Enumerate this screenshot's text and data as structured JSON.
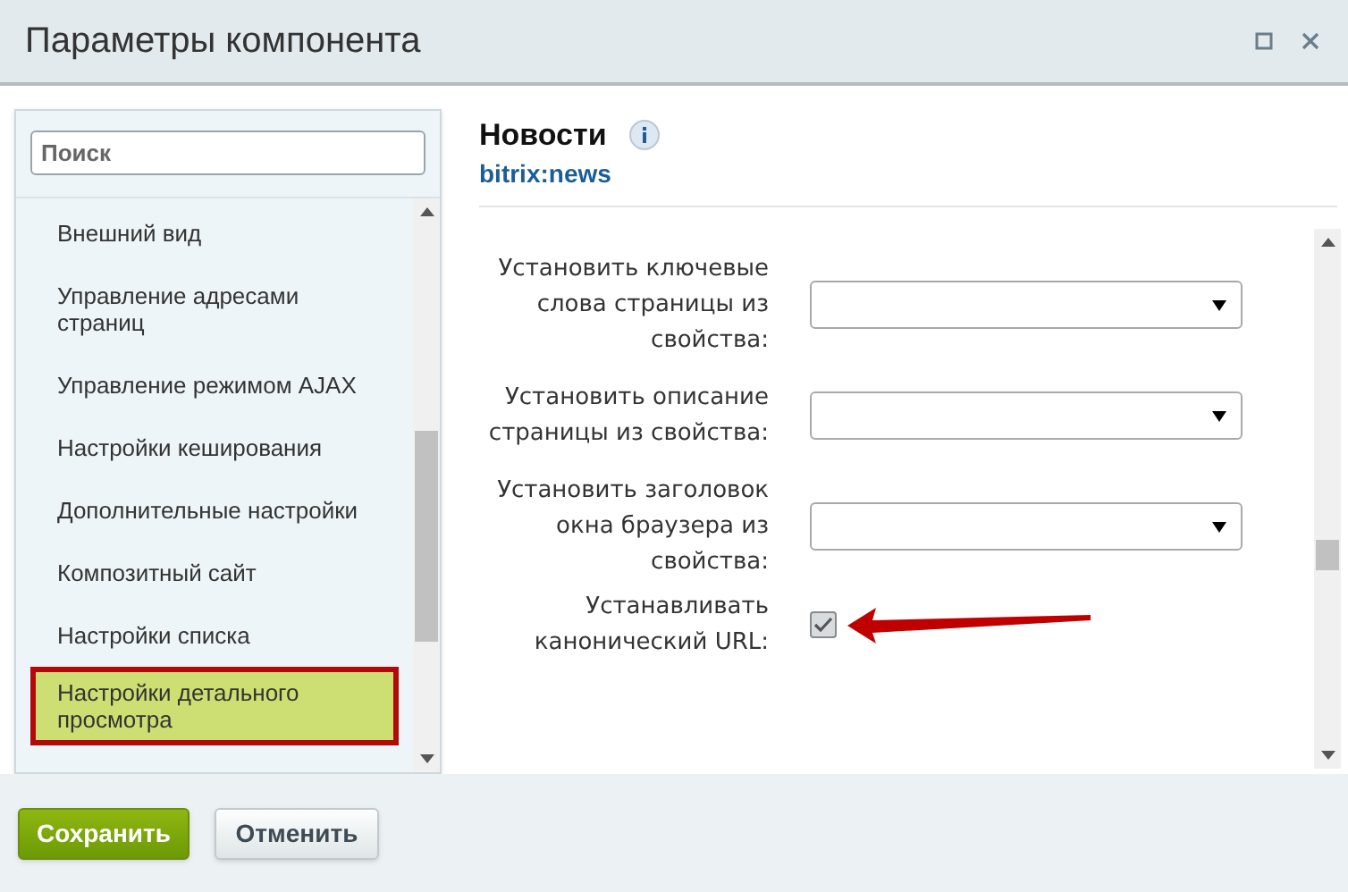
{
  "window": {
    "title": "Параметры компонента"
  },
  "sidebar": {
    "search": {
      "placeholder": "Поиск"
    },
    "items": [
      {
        "label": "Внешний вид",
        "selected": false
      },
      {
        "label": "Управление адресами страниц",
        "selected": false
      },
      {
        "label": "Управление режимом AJAX",
        "selected": false
      },
      {
        "label": "Настройки кеширования",
        "selected": false
      },
      {
        "label": "Дополнительные настройки",
        "selected": false
      },
      {
        "label": "Композитный сайт",
        "selected": false
      },
      {
        "label": "Настройки списка",
        "selected": false
      },
      {
        "label": "Настройки детального просмотра",
        "selected": true
      }
    ]
  },
  "component": {
    "title": "Новости",
    "code": "bitrix:news"
  },
  "fields": [
    {
      "kind": "select",
      "label": "Установить ключевые слова страницы из свойства:"
    },
    {
      "kind": "select",
      "label": "Установить описание страницы из свойства:"
    },
    {
      "kind": "select",
      "label": "Установить заголовок окна браузера из свойства:"
    },
    {
      "kind": "checkbox",
      "label": "Устанавливать канонический URL:",
      "checked": true
    }
  ],
  "buttons": [
    {
      "label": "Сохранить",
      "kind": "primary"
    },
    {
      "label": "Отменить",
      "kind": "secondary"
    }
  ]
}
